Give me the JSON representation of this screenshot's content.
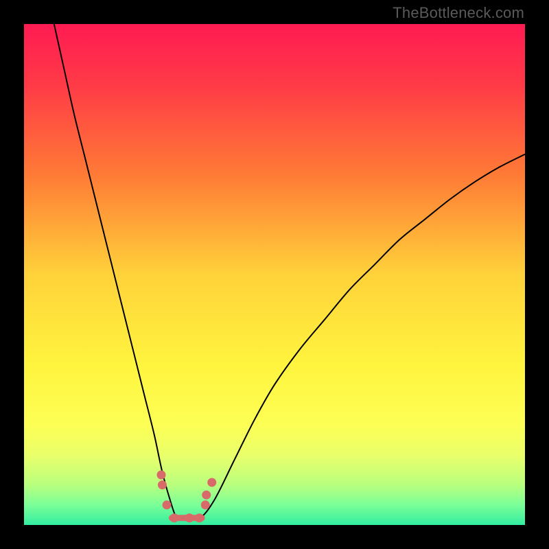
{
  "watermark": {
    "text": "TheBottleneck.com"
  },
  "chart_data": {
    "type": "line",
    "title": "",
    "xlabel": "",
    "ylabel": "",
    "xlim": [
      0,
      100
    ],
    "ylim": [
      0,
      100
    ],
    "curve": {
      "name": "bottleneck-curve",
      "x": [
        6,
        8,
        10,
        12,
        14,
        16,
        18,
        20,
        22,
        24,
        26,
        27.5,
        29,
        30.5,
        32,
        35,
        38,
        42,
        46,
        50,
        55,
        60,
        65,
        70,
        75,
        80,
        85,
        90,
        95,
        100
      ],
      "y": [
        100,
        91,
        82,
        74,
        66,
        58,
        50,
        42,
        34,
        26,
        18,
        11,
        5.5,
        1.3,
        1.3,
        1.3,
        5,
        13,
        21,
        28,
        35,
        41,
        47,
        52,
        57,
        61,
        65,
        68.5,
        71.5,
        74
      ]
    },
    "highlight_points": {
      "name": "marker-dots",
      "x": [
        27.4,
        27.6,
        28.5,
        30.0,
        33.0,
        35.0,
        36.2,
        36.4,
        37.5
      ],
      "y": [
        10.0,
        8.0,
        4.0,
        1.4,
        1.4,
        1.4,
        4.0,
        6.0,
        8.5
      ]
    },
    "flat_base": {
      "x_start": 29.5,
      "x_end": 35.5,
      "y": 1.4
    },
    "background_gradient_stops": [
      {
        "offset": 0.0,
        "color": "#ff1b52"
      },
      {
        "offset": 0.12,
        "color": "#ff3a47"
      },
      {
        "offset": 0.3,
        "color": "#ff7a36"
      },
      {
        "offset": 0.5,
        "color": "#ffd23a"
      },
      {
        "offset": 0.68,
        "color": "#fff43e"
      },
      {
        "offset": 0.8,
        "color": "#fdff55"
      },
      {
        "offset": 0.86,
        "color": "#eaff6a"
      },
      {
        "offset": 0.92,
        "color": "#b9ff7e"
      },
      {
        "offset": 0.96,
        "color": "#7bff98"
      },
      {
        "offset": 1.0,
        "color": "#33eca0"
      }
    ]
  }
}
